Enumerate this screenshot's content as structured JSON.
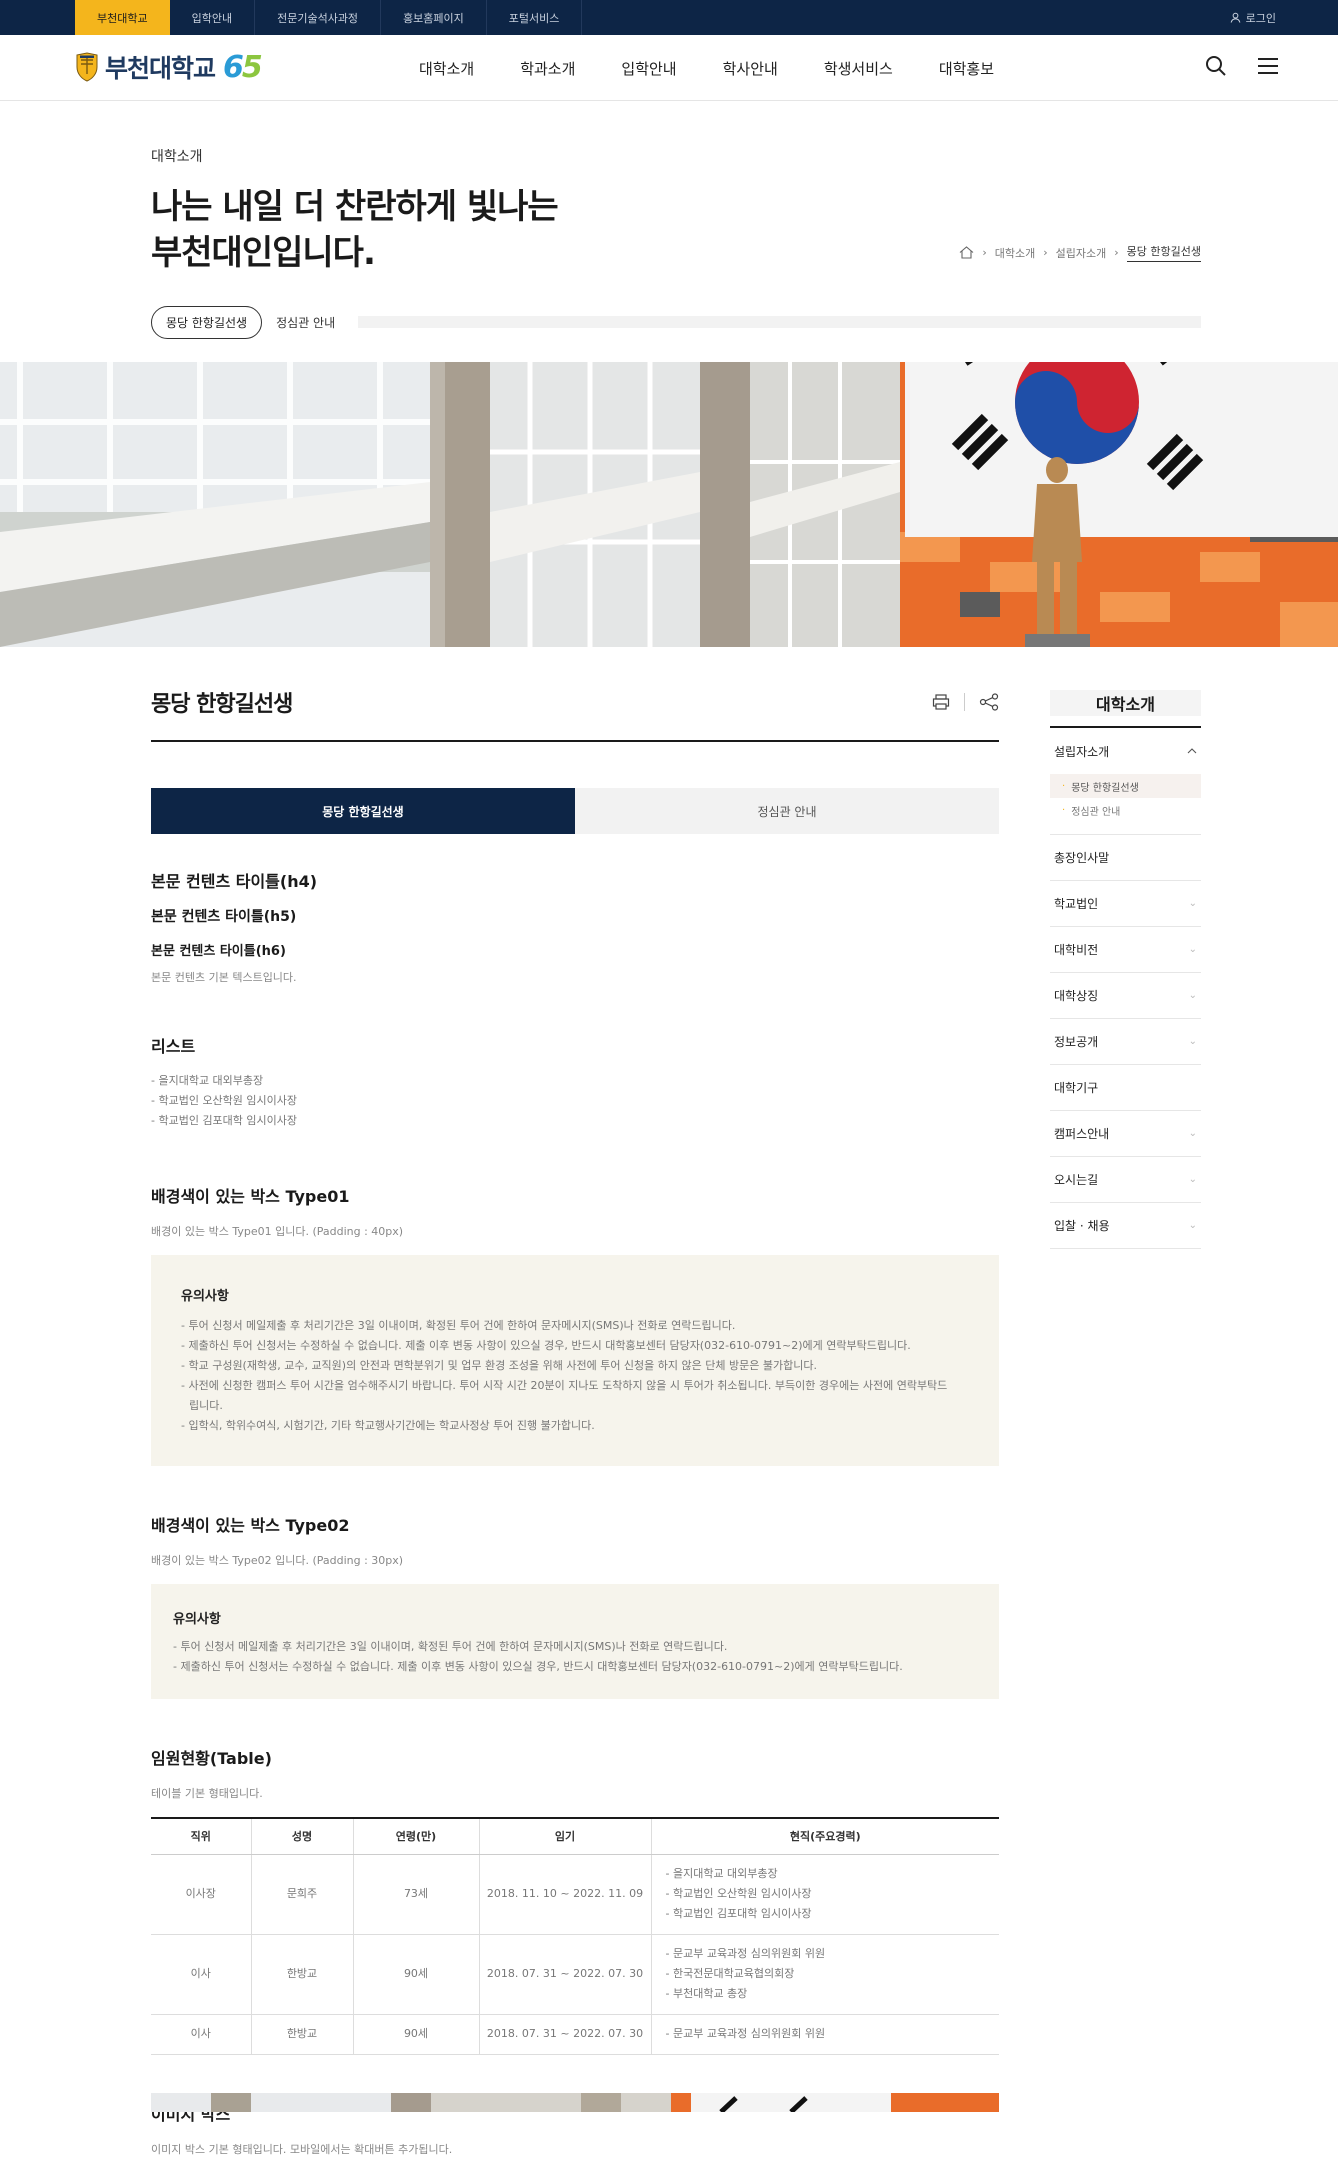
{
  "topbar": {
    "tabs": [
      "부천대학교",
      "입학안내",
      "전문기술석사과정",
      "홍보홈페이지",
      "포털서비스"
    ],
    "login": "로그인"
  },
  "header": {
    "logo_text": "부천대학교",
    "logo_number_6": "6",
    "logo_number_5": "5",
    "menu": [
      "대학소개",
      "학과소개",
      "입학안내",
      "학사안내",
      "학생서비스",
      "대학홍보"
    ]
  },
  "hero": {
    "category": "대학소개",
    "headline_line1": "나는 내일 더 찬란하게 빛나는",
    "headline_line2": "부천대인입니다."
  },
  "breadcrumb": [
    "대학소개",
    "설립자소개",
    "몽당 한항길선생"
  ],
  "subtabs": [
    "몽당 한항길선생",
    "정심관 안내"
  ],
  "content": {
    "page_title": "몽당 한항길선생",
    "tabs": [
      "몽당 한항길선생",
      "정심관 안내"
    ],
    "h4": "본문 컨텐츠 타이틀(h4)",
    "h5": "본문 컨텐츠 타이틀(h5)",
    "h6": "본문 컨텐츠 타이틀(h6)",
    "body_text": "본문 컨텐츠 기본 텍스트입니다.",
    "list_title": "리스트",
    "list_items": [
      "- 을지대학교 대외부총장",
      "- 학교법인 오산학원 임시이사장",
      "- 학교법인 김포대학 임시이사장"
    ],
    "box1": {
      "title": "배경색이 있는 박스 Type01",
      "desc": "배경이 있는 박스 Type01 입니다. (Padding : 40px)",
      "heading": "유의사항",
      "items": [
        "- 투어 신청서 메일제출 후 처리기간은 3일 이내이며, 확정된 투어 건에 한하여 문자메시지(SMS)나 전화로 연락드립니다.",
        "- 제출하신 투어 신청서는 수정하실 수 없습니다. 제출 이후 변동 사항이 있으실 경우, 반드시 대학홍보센터 담당자(032-610-0791~2)에게 연락부탁드립니다.",
        "- 학교 구성원(재학생, 교수, 교직원)의 안전과 면학분위기 및 업무 환경 조성을 위해 사전에 투어 신청을 하지 않은 단체 방문은 불가합니다.",
        "- 사전에 신청한 캠퍼스 투어 시간을 엄수해주시기 바랍니다. 투어 시작 시간 20분이 지나도 도착하지 않을 시 투어가 취소됩니다. 부득이한 경우에는 사전에 연락부탁드",
        "립니다.",
        "- 입학식, 학위수여식, 시험기간, 기타 학교행사기간에는 학교사정상 투어 진행 불가합니다."
      ]
    },
    "box2": {
      "title": "배경색이 있는 박스 Type02",
      "desc": "배경이 있는 박스 Type02 입니다. (Padding : 30px)",
      "heading": "유의사항",
      "items": [
        "- 투어 신청서 메일제출 후 처리기간은 3일 이내이며, 확정된 투어 건에 한하여 문자메시지(SMS)나 전화로 연락드립니다.",
        "- 제출하신 투어 신청서는 수정하실 수 없습니다. 제출 이후 변동 사항이 있으실 경우, 반드시 대학홍보센터 담당자(032-610-0791~2)에게 연락부탁드립니다."
      ]
    },
    "table": {
      "title": "임원현황(Table)",
      "desc": "테이블 기본 형태입니다.",
      "headers": [
        "직위",
        "성명",
        "연령(만)",
        "임기",
        "현직(주요경력)"
      ],
      "rows": [
        {
          "pos": "이사장",
          "name": "문희주",
          "age": "73세",
          "term": "2018. 11. 10 ~ 2022. 11. 09",
          "career": [
            "- 을지대학교 대외부총장",
            "- 학교법인 오산학원 임시이사장",
            "- 학교법인 김포대학 임시이사장"
          ]
        },
        {
          "pos": "이사",
          "name": "한방교",
          "age": "90세",
          "term": "2018. 07. 31 ~ 2022. 07. 30",
          "career": [
            "- 문교부 교육과정 심의위원회 위원",
            "- 한국전문대학교육협의회장",
            "- 부천대학교 총장"
          ]
        },
        {
          "pos": "이사",
          "name": "한방교",
          "age": "90세",
          "term": "2018. 07. 31 ~ 2022. 07. 30",
          "career": [
            "- 문교부 교육과정 심의위원회 위원"
          ]
        }
      ]
    },
    "image_box": {
      "title": "이미지 박스",
      "desc": "이미지 박스 기본 형태입니다. 모바일에서는 확대버튼 추가됩니다."
    }
  },
  "snb": {
    "title": "대학소개",
    "open_item": "설립자소개",
    "sub_items": [
      "몽당 한항길선생",
      "정심관 안내"
    ],
    "items": [
      "총장인사말",
      "학교법인",
      "대학비전",
      "대학상징",
      "정보공개",
      "대학기구",
      "캠퍼스안내",
      "오시는길",
      "입찰 · 채용"
    ],
    "chevrons": [
      false,
      true,
      true,
      true,
      true,
      false,
      true,
      true,
      true
    ]
  },
  "colors": {
    "navy": "#0d2546",
    "accent": "#f4b51c",
    "box_bg": "#f6f4ec"
  }
}
